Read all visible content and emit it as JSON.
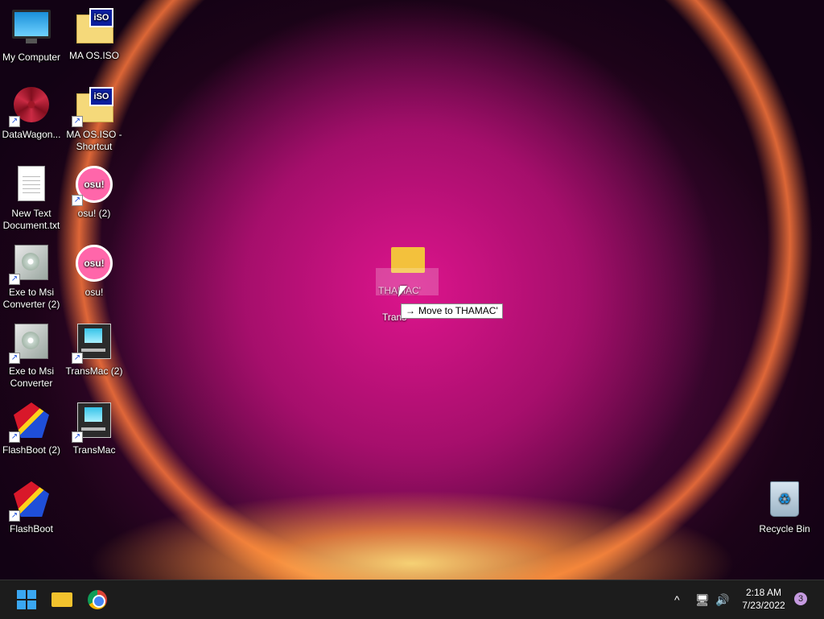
{
  "desktop": {
    "icons": [
      {
        "label": "My Computer"
      },
      {
        "label": "MA OS.ISO"
      },
      {
        "label": "DataWagon..."
      },
      {
        "label": "MA OS.ISO - Shortcut"
      },
      {
        "label": "New Text Document.txt"
      },
      {
        "label": "osu! (2)"
      },
      {
        "label": "Exe to Msi Converter (2)"
      },
      {
        "label": "osu!"
      },
      {
        "label": "Exe to Msi Converter"
      },
      {
        "label": "TransMac (2)"
      },
      {
        "label": "FlashBoot (2)"
      },
      {
        "label": "TransMac"
      },
      {
        "label": "FlashBoot"
      },
      {
        "label": "Recycle Bin"
      }
    ],
    "iso_badge": "iSO",
    "osu_badge": "osu!",
    "shortcut_arrow": "↗",
    "drag": {
      "target_label_partial": "THAMAC'",
      "source_label_partial": "Trans",
      "tooltip": "Move to THAMAC'",
      "tooltip_arrow": "→"
    }
  },
  "taskbar": {
    "tray": {
      "chevron": "^",
      "network": "🖥",
      "volume": "🔊"
    },
    "clock": {
      "time": "2:18 AM",
      "date": "7/23/2022"
    },
    "notification_count": "3"
  }
}
